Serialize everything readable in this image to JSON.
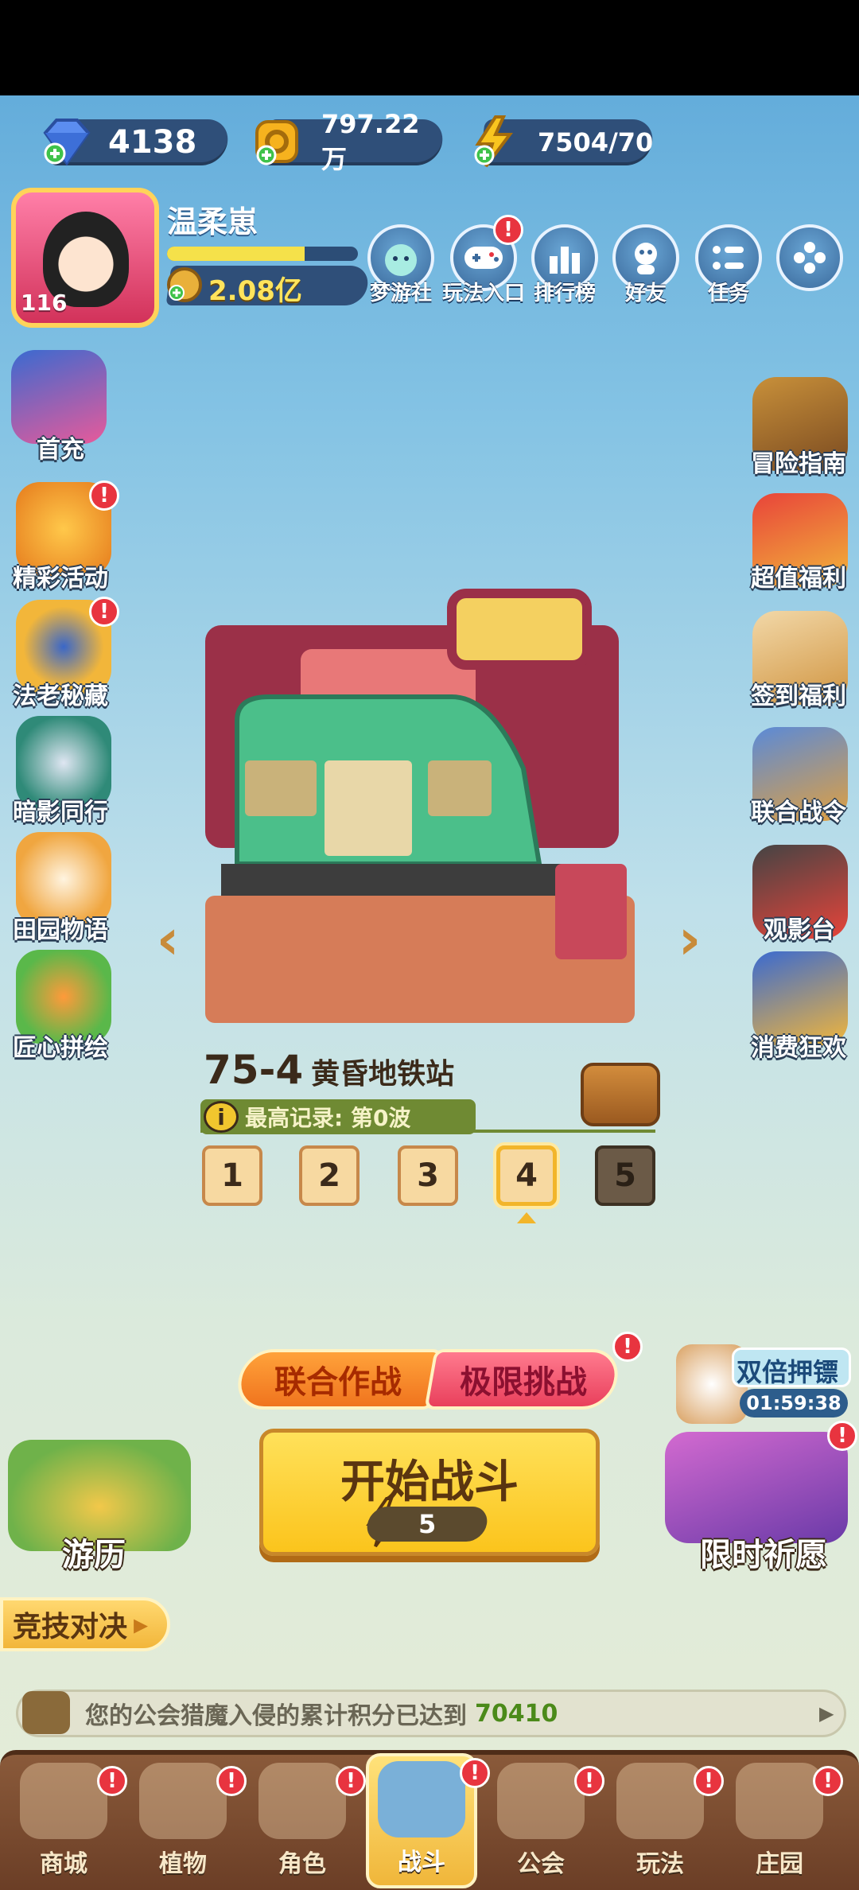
{
  "currencies": [
    {
      "name": "diamond",
      "icon": "diamond-plus-icon",
      "value": "4138"
    },
    {
      "name": "gold",
      "icon": "coin-plus-icon",
      "value": "797.22万"
    },
    {
      "name": "energy",
      "icon": "lightning-plus-icon",
      "value": "7504/70"
    }
  ],
  "profile": {
    "name": "温柔崽",
    "level": "116",
    "xp_fraction": 0.72,
    "power": "2.08亿"
  },
  "top_menu": [
    {
      "label": "梦游社",
      "icon": "creature-icon",
      "badge": ""
    },
    {
      "label": "玩法入口",
      "icon": "gamepad-icon",
      "badge": "!"
    },
    {
      "label": "排行榜",
      "icon": "bar-chart-icon",
      "badge": ""
    },
    {
      "label": "好友",
      "icon": "friend-icon",
      "badge": ""
    },
    {
      "label": "任务",
      "icon": "task-list-icon",
      "badge": ""
    },
    {
      "label": "",
      "icon": "more-dots-icon",
      "badge": ""
    }
  ],
  "left_menu": [
    {
      "label": "首充",
      "badge": ""
    },
    {
      "label": "精彩活动",
      "badge": "!"
    },
    {
      "label": "法老秘藏",
      "badge": "!"
    },
    {
      "label": "暗影同行",
      "badge": ""
    },
    {
      "label": "田园物语",
      "badge": ""
    },
    {
      "label": "匠心拼绘",
      "badge": ""
    }
  ],
  "right_menu": [
    {
      "label": "冒险指南"
    },
    {
      "label": "超值福利"
    },
    {
      "label": "签到福利"
    },
    {
      "label": "联合战令"
    },
    {
      "label": "观影台"
    },
    {
      "label": "消费狂欢"
    }
  ],
  "stage": {
    "number": "75-4",
    "name": "黄昏地铁站",
    "record": "最高记录: 第0波",
    "waves": [
      "1",
      "2",
      "3",
      "4",
      "5"
    ],
    "selected_wave": "4"
  },
  "modes": {
    "coop": "联合作战",
    "extreme": "极限挑战"
  },
  "start": {
    "label": "开始战斗",
    "cost": "5"
  },
  "double_escort": {
    "title": "双倍押镖",
    "timer": "01:59:38"
  },
  "travel_label": "游历",
  "limited_wish_label": "限时祈愿",
  "arena_label": "竞技对决",
  "notice": {
    "text": "您的公会猎魔入侵的累计积分已达到",
    "value": "70410"
  },
  "bottom_nav": [
    {
      "label": "商城",
      "active": false
    },
    {
      "label": "植物",
      "active": false
    },
    {
      "label": "角色",
      "active": false
    },
    {
      "label": "战斗",
      "active": true
    },
    {
      "label": "公会",
      "active": false
    },
    {
      "label": "玩法",
      "active": false
    },
    {
      "label": "庄园",
      "active": false
    }
  ],
  "colors": {
    "badge": "#e8343f",
    "start_button": "#fbc41c",
    "nav_bg": "#7a4a30"
  }
}
